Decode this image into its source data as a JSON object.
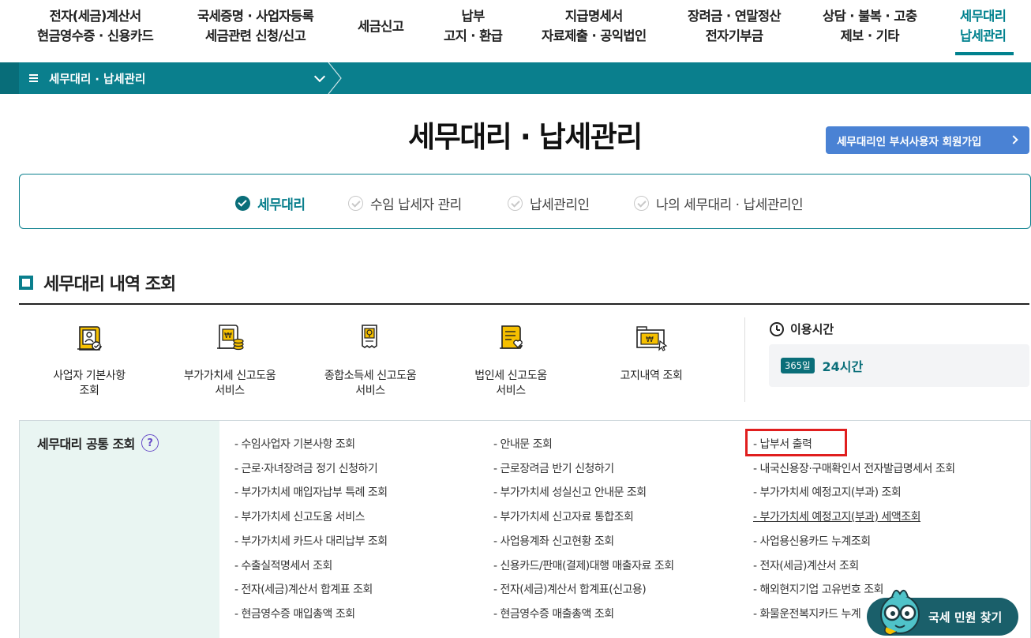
{
  "topnav": {
    "items": [
      {
        "line1": "전자(세금)계산서",
        "line2": "현금영수증 · 신용카드"
      },
      {
        "line1": "국세증명 · 사업자등록",
        "line2": "세금관련 신청/신고"
      },
      {
        "line1": "세금신고",
        "line2": ""
      },
      {
        "line1": "납부",
        "line2": "고지 · 환급"
      },
      {
        "line1": "지급명세서",
        "line2": "자료제출 · 공익법인"
      },
      {
        "line1": "장려금 · 연말정산",
        "line2": "전자기부금"
      },
      {
        "line1": "상담 · 불복 · 고충",
        "line2": "제보 · 기타"
      },
      {
        "line1": "세무대리",
        "line2": "납세관리"
      }
    ],
    "active_index": 7,
    "accent_color": "#00818e"
  },
  "breadcrumb": {
    "label": "세무대리 · 납세관리"
  },
  "page_title": "세무대리 · 납세관리",
  "signup_button": "세무대리인 부서사용자 회원가입",
  "tabs": [
    {
      "label": "세무대리",
      "active": true
    },
    {
      "label": "수임 납세자 관리",
      "active": false
    },
    {
      "label": "납세관리인",
      "active": false
    },
    {
      "label": "나의 세무대리 · 납세관리인",
      "active": false
    }
  ],
  "section_title": "세무대리 내역 조회",
  "services": [
    {
      "icon": "business-info-icon",
      "label_line1": "사업자 기본사항",
      "label_line2": "조회"
    },
    {
      "icon": "vat-help-icon",
      "label_line1": "부가가치세 신고도움",
      "label_line2": "서비스"
    },
    {
      "icon": "income-tax-help-icon",
      "label_line1": "종합소득세 신고도움",
      "label_line2": "서비스"
    },
    {
      "icon": "corp-tax-help-icon",
      "label_line1": "법인세 신고도움",
      "label_line2": "서비스"
    },
    {
      "icon": "notice-history-icon",
      "label_line1": "고지내역 조회",
      "label_line2": ""
    }
  ],
  "usage": {
    "title": "이용시간",
    "badge": "365일",
    "hours": "24시간"
  },
  "common_lookup": {
    "title": "세무대리 공통 조회",
    "help": "?",
    "col1": [
      "수임사업자 기본사항 조회",
      "근로·자녀장려금 정기 신청하기",
      "부가가치세 매입자납부 특례 조회",
      "부가가치세 신고도움 서비스",
      "부가가치세 카드사 대리납부 조회",
      "수출실적명세서 조회",
      "전자(세금)계산서 합계표 조회",
      "현금영수증 매입총액 조회"
    ],
    "col2": [
      "안내문 조회",
      "근로장려금 반기 신청하기",
      "부가가치세 성실신고 안내문 조회",
      "부가가치세 신고자료 통합조회",
      "사업용계좌 신고현황 조회",
      "신용카드/판매(결제)대행 매출자료 조회",
      "전자(세금)계산서 합계표(신고용)",
      "현금영수증 매출총액 조회"
    ],
    "col3": [
      "납부서 출력",
      "내국신용장·구매확인서 전자발급명세서 조회",
      "부가가치세 예정고지(부과) 조회",
      "부가가치세 예정고지(부과) 세액조회",
      "사업용신용카드 누계조회",
      "전자(세금)계산서 조회",
      "해외현지기업 고유번호 조회",
      "화물운전복지카드 누계"
    ]
  },
  "chat_button": "국세 민원 찾기"
}
